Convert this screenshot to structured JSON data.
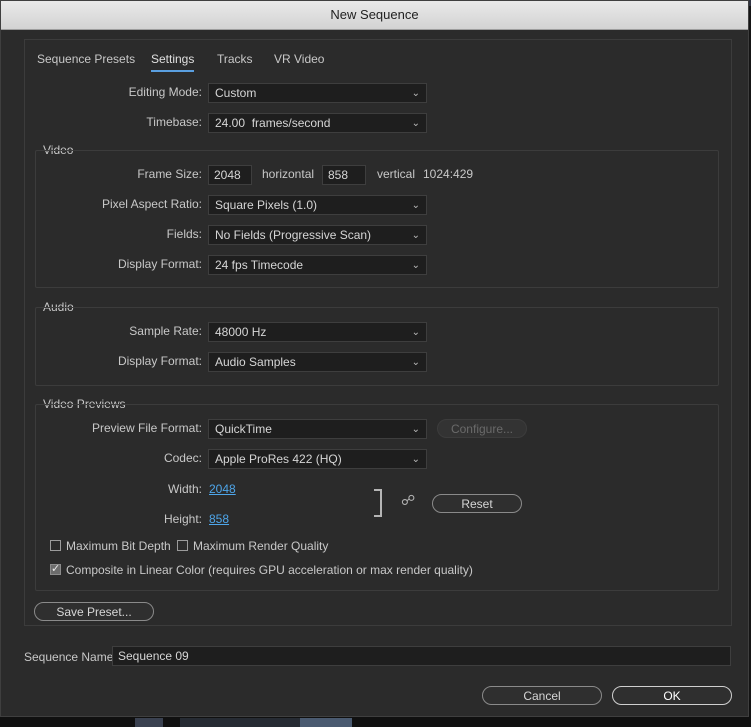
{
  "window": {
    "title": "New Sequence"
  },
  "tabs": [
    {
      "label": "Sequence Presets"
    },
    {
      "label": "Settings"
    },
    {
      "label": "Tracks"
    },
    {
      "label": "VR Video"
    }
  ],
  "active_tab": "Settings",
  "settings": {
    "editing_mode": {
      "label": "Editing Mode:",
      "value": "Custom"
    },
    "timebase": {
      "label": "Timebase:",
      "value": "24.00  frames/second"
    }
  },
  "video": {
    "title": "Video",
    "frame_size": {
      "label": "Frame Size:",
      "horizontal_value": "2048",
      "horizontal_label": "horizontal",
      "vertical_value": "858",
      "vertical_label": "vertical",
      "ratio": "1024:429"
    },
    "pixel_aspect_ratio": {
      "label": "Pixel Aspect Ratio:",
      "value": "Square Pixels (1.0)"
    },
    "fields": {
      "label": "Fields:",
      "value": "No Fields (Progressive Scan)"
    },
    "display_format": {
      "label": "Display Format:",
      "value": "24 fps Timecode"
    }
  },
  "audio": {
    "title": "Audio",
    "sample_rate": {
      "label": "Sample Rate:",
      "value": "48000 Hz"
    },
    "display_format": {
      "label": "Display Format:",
      "value": "Audio Samples"
    }
  },
  "video_previews": {
    "title": "Video Previews",
    "preview_file_format": {
      "label": "Preview File Format:",
      "value": "QuickTime"
    },
    "configure_label": "Configure...",
    "codec": {
      "label": "Codec:",
      "value": "Apple ProRes 422 (HQ)"
    },
    "width": {
      "label": "Width:",
      "value": "2048"
    },
    "height": {
      "label": "Height:",
      "value": "858"
    },
    "reset_label": "Reset",
    "max_bit_depth": {
      "label": "Maximum Bit Depth",
      "checked": false
    },
    "max_render_quality": {
      "label": "Maximum Render Quality",
      "checked": false
    },
    "composite_linear": {
      "label": "Composite in Linear Color (requires GPU acceleration or max render quality)",
      "checked": true
    }
  },
  "save_preset_label": "Save Preset...",
  "sequence_name": {
    "label": "Sequence Name:",
    "value": "Sequence 09"
  },
  "buttons": {
    "cancel": "Cancel",
    "ok": "OK"
  },
  "colors": {
    "accent": "#4ea6ea",
    "panel": "#2b2b2b",
    "field": "#1e1e1e"
  },
  "icons": [
    "chevron-down-icon",
    "chain-link-icon",
    "checkmark-icon"
  ]
}
